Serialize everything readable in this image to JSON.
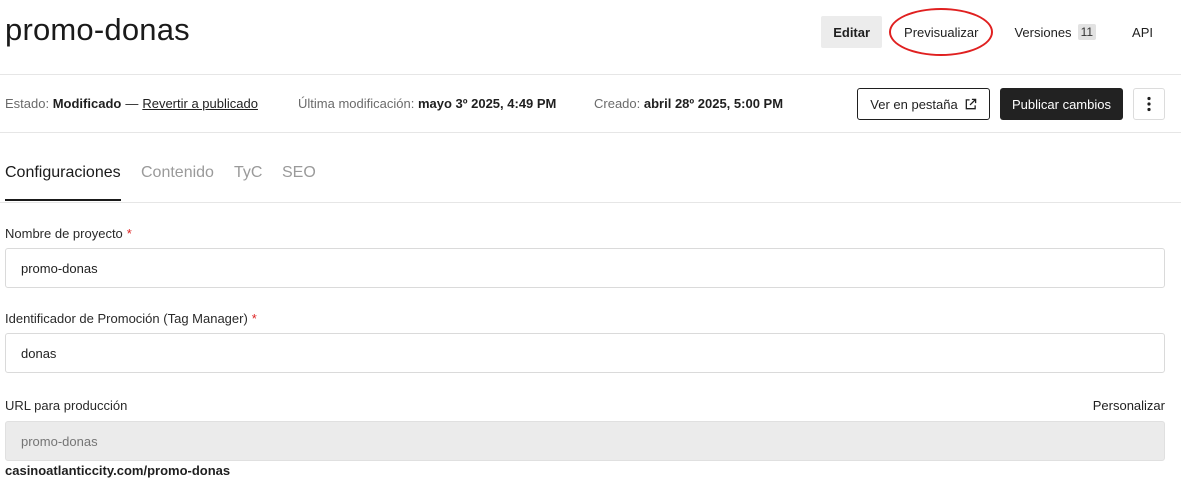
{
  "header": {
    "title": "promo-donas",
    "actions": {
      "edit": "Editar",
      "preview": "Previsualizar",
      "versions": "Versiones",
      "versions_count": "11",
      "api": "API"
    }
  },
  "status": {
    "label": "Estado:",
    "value": "Modificado",
    "dash": "—",
    "revert_link": "Revertir a publicado",
    "modified_label": "Última modificación:",
    "modified_value": "mayo 3º 2025, 4:49 PM",
    "created_label": "Creado:",
    "created_value": "abril 28º 2025, 5:00 PM",
    "view_tab_button": "Ver en pestaña",
    "publish_button": "Publicar cambios",
    "icons": {
      "external_link": "external-link-icon",
      "more": "more-vertical-icon"
    }
  },
  "tabs": [
    "Configuraciones",
    "Contenido",
    "TyC",
    "SEO"
  ],
  "form": {
    "project_name": {
      "label": "Nombre de proyecto",
      "required_mark": "*",
      "value": "promo-donas"
    },
    "promo_id": {
      "label": "Identificador de Promoción (Tag Manager)",
      "required_mark": "*",
      "value": "donas"
    },
    "prod_url": {
      "label": "URL para producción",
      "customize": "Personalizar",
      "placeholder": "promo-donas",
      "full_url": "casinoatlanticcity.com/promo-donas"
    }
  },
  "colors": {
    "primary_dark": "#222222",
    "highlight_circle": "#e02020",
    "required": "#dd2222"
  }
}
